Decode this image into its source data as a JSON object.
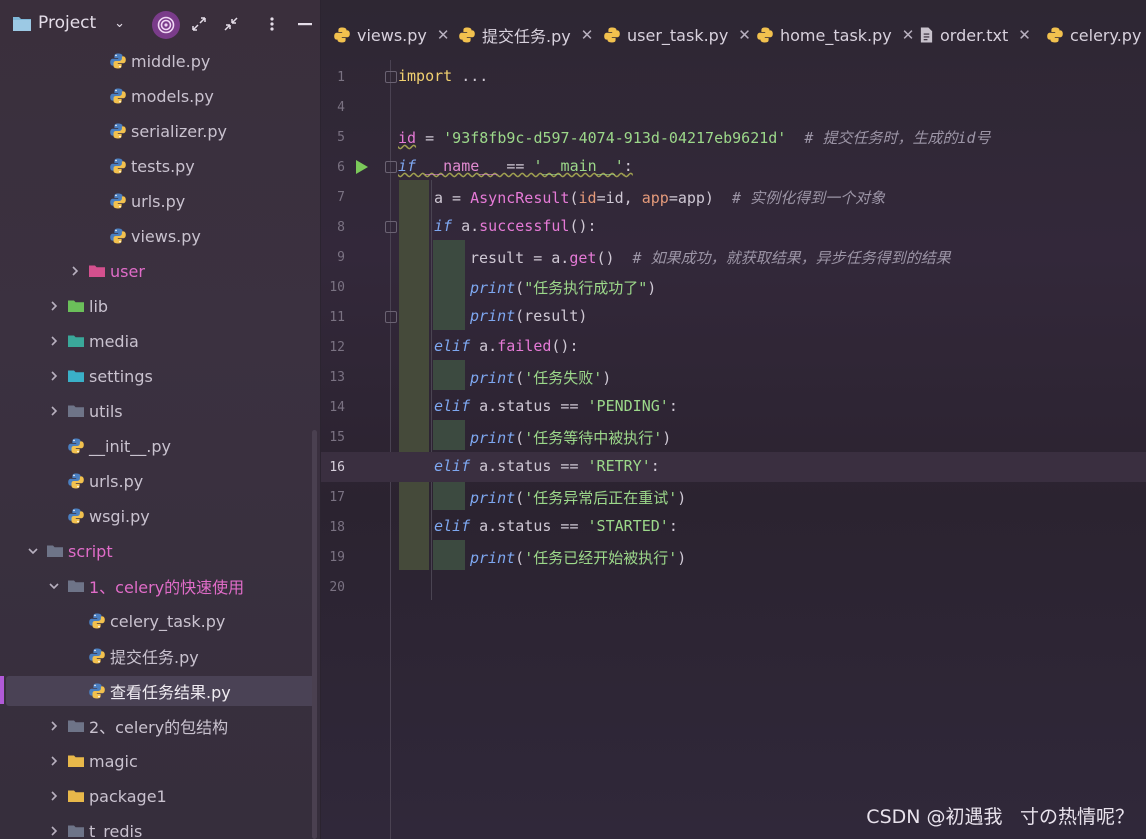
{
  "project_panel": {
    "title": "Project",
    "tree": [
      {
        "label": "middle.py",
        "type": "py",
        "indent": 3
      },
      {
        "label": "models.py",
        "type": "py",
        "indent": 3
      },
      {
        "label": "serializer.py",
        "type": "py",
        "indent": 3
      },
      {
        "label": "tests.py",
        "type": "py",
        "indent": 3
      },
      {
        "label": "urls.py",
        "type": "py",
        "indent": 3
      },
      {
        "label": "views.py",
        "type": "py",
        "indent": 3
      },
      {
        "label": "user",
        "type": "folder-pink",
        "indent": 2,
        "expand": "collapsed"
      },
      {
        "label": "lib",
        "type": "folder-green",
        "indent": 1,
        "expand": "collapsed"
      },
      {
        "label": "media",
        "type": "folder-teal",
        "indent": 1,
        "expand": "collapsed"
      },
      {
        "label": "settings",
        "type": "folder-cyan",
        "indent": 1,
        "expand": "collapsed"
      },
      {
        "label": "utils",
        "type": "folder-gray",
        "indent": 1,
        "expand": "collapsed"
      },
      {
        "label": "__init__.py",
        "type": "py",
        "indent": 1
      },
      {
        "label": "urls.py",
        "type": "py",
        "indent": 1
      },
      {
        "label": "wsgi.py",
        "type": "py",
        "indent": 1
      },
      {
        "label": "script",
        "type": "folder-gray",
        "indent": 0,
        "expand": "expanded",
        "pink": true
      },
      {
        "label": "1、celery的快速使用",
        "type": "folder-gray",
        "indent": 1,
        "expand": "expanded",
        "pink": true
      },
      {
        "label": "celery_task.py",
        "type": "py",
        "indent": 2
      },
      {
        "label": "提交任务.py",
        "type": "py",
        "indent": 2
      },
      {
        "label": "查看任务结果.py",
        "type": "py",
        "indent": 2,
        "selected": true
      },
      {
        "label": "2、celery的包结构",
        "type": "folder-gray",
        "indent": 1,
        "expand": "collapsed"
      },
      {
        "label": "magic",
        "type": "folder-yellow",
        "indent": 1,
        "expand": "collapsed"
      },
      {
        "label": "package1",
        "type": "folder-yellow",
        "indent": 1,
        "expand": "collapsed"
      },
      {
        "label": "t_redis",
        "type": "folder-gray",
        "indent": 1,
        "expand": "collapsed"
      }
    ]
  },
  "tabs": [
    {
      "label": "views.py",
      "closable": true
    },
    {
      "label": "提交任务.py",
      "closable": true
    },
    {
      "label": "user_task.py",
      "closable": true
    },
    {
      "label": "home_task.py",
      "closable": true
    },
    {
      "label": "order.txt",
      "closable": true,
      "icon": "text-file-icon"
    },
    {
      "label": "celery.py",
      "closable": false
    }
  ],
  "editor": {
    "current_line": 16,
    "lines": [
      {
        "n": "1"
      },
      {
        "n": "4"
      },
      {
        "n": "5"
      },
      {
        "n": "6"
      },
      {
        "n": "7"
      },
      {
        "n": "8"
      },
      {
        "n": "9"
      },
      {
        "n": "10"
      },
      {
        "n": "11"
      },
      {
        "n": "12"
      },
      {
        "n": "13"
      },
      {
        "n": "14"
      },
      {
        "n": "15"
      },
      {
        "n": "16"
      },
      {
        "n": "17"
      },
      {
        "n": "18"
      },
      {
        "n": "19"
      },
      {
        "n": "20"
      }
    ],
    "code": {
      "l1_import": "import",
      "l1_dots": " ...",
      "l5_id": "id",
      "l5_eq": " = ",
      "l5_str": "'93f8fb9c-d597-4074-913d-04217eb9621d'",
      "l5_cmt": "  # 提交任务时，生成的id号",
      "l6_if": "if",
      "l6_name": " __name__",
      "l6_eqeq": " == ",
      "l6_main": "'__main__'",
      "l6_colon": ":",
      "l7_a": "a = ",
      "l7_fn": "AsyncResult",
      "l7_open": "(",
      "l7_p1": "id",
      "l7_v1": "=id, ",
      "l7_p2": "app",
      "l7_v2": "=app)",
      "l7_cmt": "  # 实例化得到一个对象",
      "l8_if": "if",
      "l8_rest": " a.",
      "l8_fn": "successful",
      "l8_end": "():",
      "l9_a": "result = a.",
      "l9_fn": "get",
      "l9_end": "()",
      "l9_cmt": "  # 如果成功，就获取结果，异步任务得到的结果",
      "l10_print": "print",
      "l10_arg": "(",
      "l10_str": "\"任务执行成功了\"",
      "l10_end": ")",
      "l11_print": "print",
      "l11_arg": "(result)",
      "l12_elif": "elif",
      "l12_rest": " a.",
      "l12_fn": "failed",
      "l12_end": "():",
      "l13_print": "print",
      "l13_open": "(",
      "l13_str": "'任务失败'",
      "l13_end": ")",
      "l14_elif": "elif",
      "l14_rest": " a.status == ",
      "l14_str": "'PENDING'",
      "l14_end": ":",
      "l15_print": "print",
      "l15_open": "(",
      "l15_str": "'任务等待中被执行'",
      "l15_end": ")",
      "l16_elif": "elif",
      "l16_rest": " a.status == ",
      "l16_str": "'RETRY'",
      "l16_end": ":",
      "l17_print": "print",
      "l17_open": "(",
      "l17_str": "'任务异常后正在重试'",
      "l17_end": ")",
      "l18_elif": "elif",
      "l18_rest": " a.status == ",
      "l18_str": "'STARTED'",
      "l18_end": ":",
      "l19_print": "print",
      "l19_open": "(",
      "l19_str": "'任务已经开始被执行'",
      "l19_end": ")"
    }
  },
  "watermark": "CSDN @初遇我ㅤ寸の热情呢？",
  "colors": {
    "accent": "#b15ad8",
    "python_icon_blue": "#4a7fc0",
    "python_icon_yellow": "#f2c14e",
    "run_green": "#7bc95a"
  }
}
